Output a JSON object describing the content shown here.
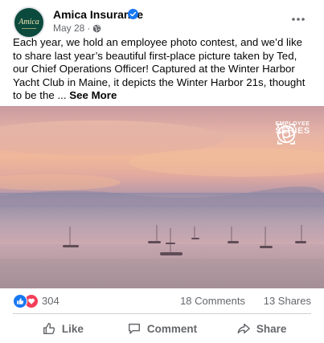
{
  "post": {
    "page_name": "Amica Insurance",
    "date": "May 28",
    "date_separator": "·",
    "avatar_text": "Amica",
    "text": "Each year, we hold an employee photo contest, and we’d like to share last year’s beautiful first-place picture taken by Ted, our Chief Operations Officer! Captured at the Winter Harbor Yacht Club in Maine, it depicts the Winter Harbor 21s, thought to be the ",
    "text_ellipsis": "... ",
    "see_more": "See More",
    "badge": {
      "line1": "EMPLOYEE",
      "line2": "SERIES"
    }
  },
  "engagement": {
    "reaction_count": "304",
    "comments": "18 Comments",
    "shares": "13 Shares",
    "reactions": [
      "like-icon",
      "love-icon"
    ]
  },
  "actions": {
    "like": "Like",
    "comment": "Comment",
    "share": "Share"
  },
  "colors": {
    "like_blue": "#1877f2",
    "love_red": "#f33e58",
    "secondary_text": "#65676b",
    "brand_green": "#0b4a3c"
  }
}
